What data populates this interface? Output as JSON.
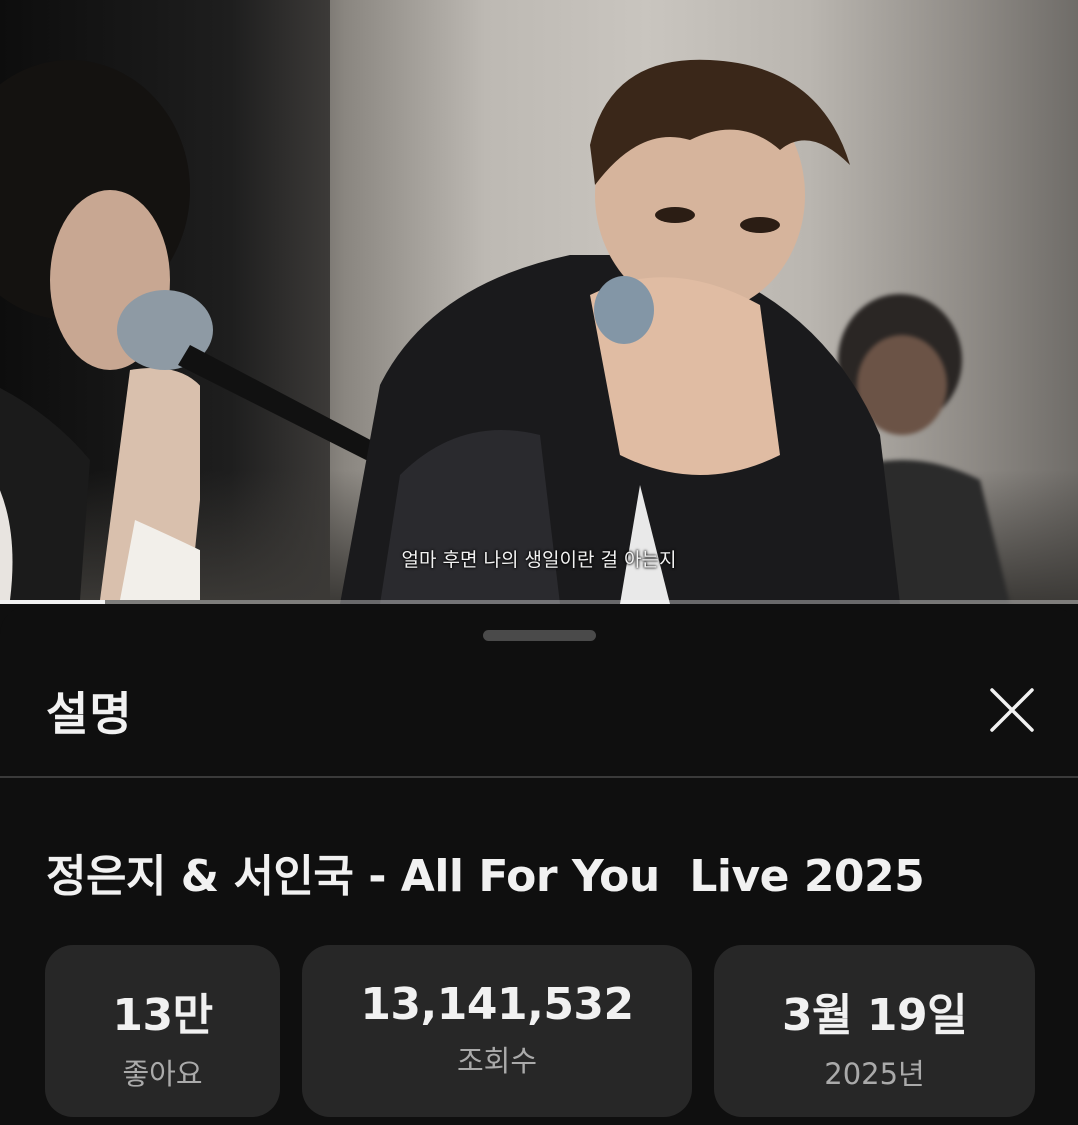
{
  "video": {
    "caption": "얼마 후면 나의 생일이란 걸 아는지",
    "progress_fraction": 0.097
  },
  "sheet": {
    "title": "설명",
    "close_icon": "close-icon"
  },
  "description": {
    "video_title": "정은지 & 서인국 - All For You  Live 2025",
    "stats": {
      "likes": {
        "value": "13만",
        "label": "좋아요"
      },
      "views": {
        "value": "13,141,532",
        "label": "조회수"
      },
      "date": {
        "value": "3월 19일",
        "label": "2025년"
      }
    }
  },
  "colors": {
    "background": "#0f0f0f",
    "stat_card": "#272727",
    "primary_text": "#f1f1f1",
    "secondary_text": "#aaaaaa"
  }
}
